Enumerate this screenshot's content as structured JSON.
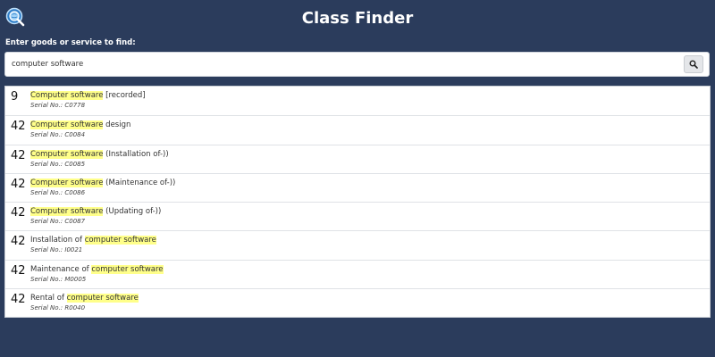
{
  "header": {
    "title": "Class Finder"
  },
  "search": {
    "label": "Enter goods or service to find:",
    "value": "computer software",
    "button_icon": "search-icon"
  },
  "results": [
    {
      "class": "9",
      "pre": "",
      "highlight": "Computer software",
      "post": " [recorded]",
      "serial_label": "Serial No.: ",
      "serial": "C0778"
    },
    {
      "class": "42",
      "pre": "",
      "highlight": "Computer software",
      "post": " design",
      "serial_label": "Serial No.: ",
      "serial": "C0084"
    },
    {
      "class": "42",
      "pre": "",
      "highlight": "Computer software",
      "post": " (Installation of-))",
      "serial_label": "Serial No.: ",
      "serial": "C0085"
    },
    {
      "class": "42",
      "pre": "",
      "highlight": "Computer software",
      "post": " (Maintenance of-))",
      "serial_label": "Serial No.: ",
      "serial": "C0086"
    },
    {
      "class": "42",
      "pre": "",
      "highlight": "Computer software",
      "post": " (Updating of-))",
      "serial_label": "Serial No.: ",
      "serial": "C0087"
    },
    {
      "class": "42",
      "pre": "Installation of ",
      "highlight": "computer software",
      "post": "",
      "serial_label": "Serial No.: ",
      "serial": "I0021"
    },
    {
      "class": "42",
      "pre": "Maintenance of ",
      "highlight": "computer software",
      "post": "",
      "serial_label": "Serial No.: ",
      "serial": "M0005"
    },
    {
      "class": "42",
      "pre": "Rental of ",
      "highlight": "computer software",
      "post": "",
      "serial_label": "Serial No.: ",
      "serial": "R0040"
    }
  ],
  "colors": {
    "background": "#2b3c5c",
    "highlight": "#ffff8a",
    "logo_blue": "#3a8fd8"
  }
}
